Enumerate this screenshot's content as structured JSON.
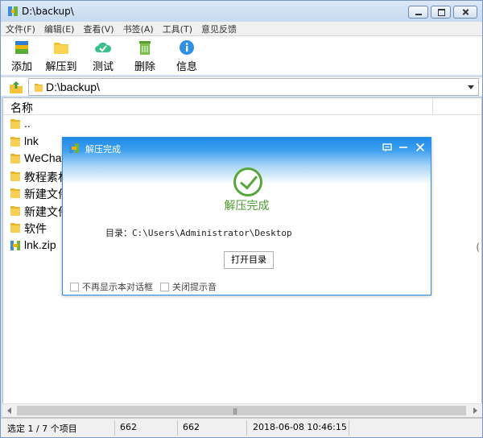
{
  "window": {
    "title": "D:\\backup\\"
  },
  "menu": [
    "文件(F)",
    "编辑(E)",
    "查看(V)",
    "书签(A)",
    "工具(T)",
    "意见反馈"
  ],
  "toolbar": [
    {
      "label": "添加",
      "icon": "add-archive-icon"
    },
    {
      "label": "解压到",
      "icon": "folder-extract-icon"
    },
    {
      "label": "测试",
      "icon": "cloud-test-icon"
    },
    {
      "label": "删除",
      "icon": "trash-icon"
    },
    {
      "label": "信息",
      "icon": "info-icon"
    }
  ],
  "address": {
    "path": "D:\\backup\\"
  },
  "list": {
    "header": "名称",
    "rows": [
      {
        "name": "..",
        "icon": "folder-icon"
      },
      {
        "name": "lnk",
        "icon": "folder-icon"
      },
      {
        "name": "WeChat",
        "icon": "folder-icon"
      },
      {
        "name": "教程素材",
        "icon": "folder-icon"
      },
      {
        "name": "新建文件",
        "icon": "folder-icon"
      },
      {
        "name": "新建文件",
        "icon": "folder-icon"
      },
      {
        "name": "软件",
        "icon": "folder-icon"
      },
      {
        "name": "lnk.zip",
        "icon": "zip-icon"
      }
    ],
    "right_mark": "("
  },
  "status": {
    "selection": "选定 1 / 7 个项目",
    "size": "662",
    "packed": "662",
    "modified": "2018-06-08 10:46:15"
  },
  "dialog": {
    "title": "解压完成",
    "message": "解压完成",
    "dir_line": "目录：C:\\Users\\Administrator\\Desktop",
    "open_button": "打开目录",
    "option1": "不再显示本对话框",
    "option2": "关闭提示音"
  },
  "colors": {
    "accent": "#2f8de6",
    "success": "#58a639"
  }
}
